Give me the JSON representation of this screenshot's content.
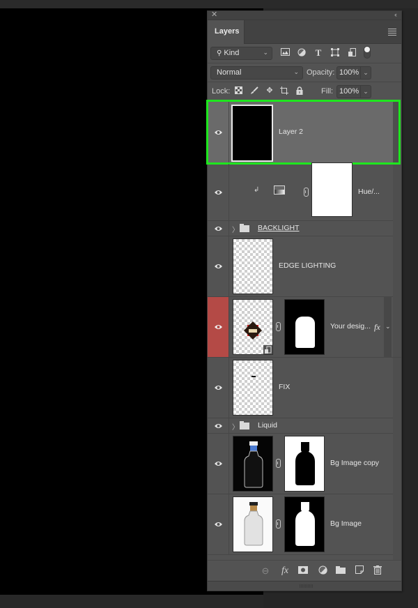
{
  "panel": {
    "title": "Layers",
    "close_icon": "close-icon",
    "collapse_icon": "double-chevron-left-icon",
    "menu_icon": "hamburger-menu-icon"
  },
  "filter": {
    "kind_label": "Kind",
    "icons": [
      "image-filter-icon",
      "adjustment-filter-icon",
      "type-filter-icon",
      "shape-filter-icon",
      "smart-object-filter-icon",
      "filter-toggle-icon"
    ]
  },
  "blend": {
    "mode": "Normal",
    "opacity_label": "Opacity:",
    "opacity_value": "100%"
  },
  "lock": {
    "label": "Lock:",
    "icons": [
      "lock-transparent-pixels-icon",
      "lock-image-pixels-icon",
      "lock-position-icon",
      "lock-artboard-icon",
      "lock-all-icon"
    ],
    "fill_label": "Fill:",
    "fill_value": "100%"
  },
  "layers": [
    {
      "name": "Layer 2",
      "type": "pixel",
      "selected": true,
      "visible": true
    },
    {
      "name": "Hue/...",
      "type": "adjustment",
      "clipped": true,
      "visible": true
    },
    {
      "name": "BACKLIGHT",
      "type": "group",
      "visible": true
    },
    {
      "name": "EDGE LIGHTING",
      "type": "pixel",
      "visible": true
    },
    {
      "name": "Your desig...",
      "type": "smart-object",
      "has_mask": true,
      "has_fx": true,
      "fx_label": "fx",
      "visible": true,
      "eye_color": "#b44a46"
    },
    {
      "name": "FIX",
      "type": "pixel",
      "visible": true
    },
    {
      "name": "Liquid",
      "type": "group",
      "visible": true
    },
    {
      "name": "Bg Image copy",
      "type": "pixel",
      "has_mask": true,
      "visible": true
    },
    {
      "name": "Bg Image",
      "type": "pixel",
      "has_mask": true,
      "visible": true
    }
  ],
  "footer": {
    "icons": [
      "link-layers-icon",
      "fx-icon",
      "add-mask-icon",
      "adjustment-layer-icon",
      "new-group-icon",
      "new-layer-icon",
      "delete-layer-icon"
    ],
    "fx_label": "fx"
  },
  "colors": {
    "selection_outline": "#1ee61e",
    "panel_bg": "#535353",
    "selected_row": "#6a6a6a",
    "red_eye_bg": "#b44a46"
  }
}
